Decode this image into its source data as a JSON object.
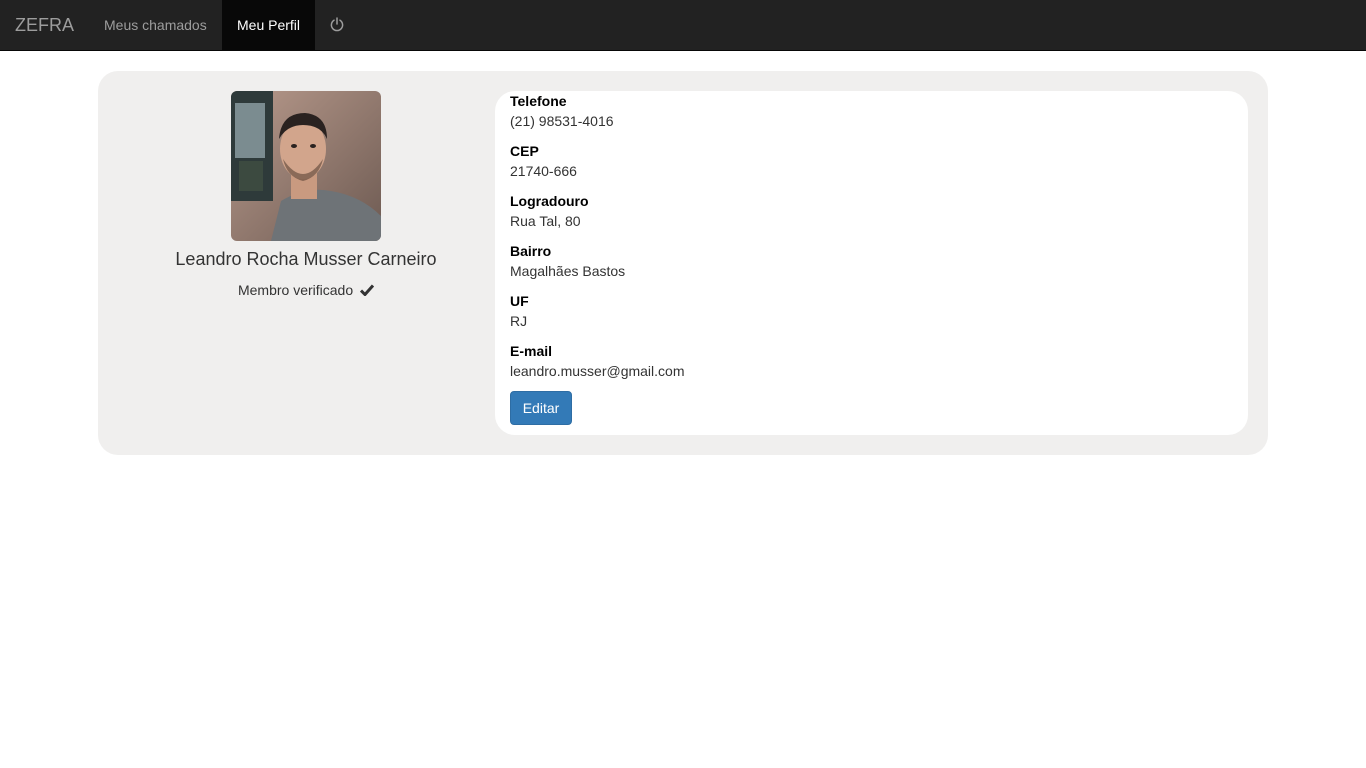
{
  "navbar": {
    "brand": "ZEFRA",
    "links": [
      {
        "label": "Meus chamados",
        "active": false
      },
      {
        "label": "Meu Perfil",
        "active": true
      }
    ],
    "power_icon": "power-icon"
  },
  "profile": {
    "name": "Leandro Rocha Musser Carneiro",
    "verified_label": "Membro verificado",
    "verified_icon": "check-icon"
  },
  "fields": [
    {
      "label": "Telefone",
      "value": "(21) 98531-4016"
    },
    {
      "label": "CEP",
      "value": "21740-666"
    },
    {
      "label": "Logradouro",
      "value": "Rua Tal, 80"
    },
    {
      "label": "Bairro",
      "value": "Magalhães Bastos"
    },
    {
      "label": "UF",
      "value": "RJ"
    },
    {
      "label": "E-mail",
      "value": "leandro.musser@gmail.com"
    }
  ],
  "edit_button_label": "Editar",
  "colors": {
    "navbar_bg": "#222222",
    "active_link_bg": "#080808",
    "panel_bg": "#f0efee",
    "primary_button": "#337ab7"
  }
}
